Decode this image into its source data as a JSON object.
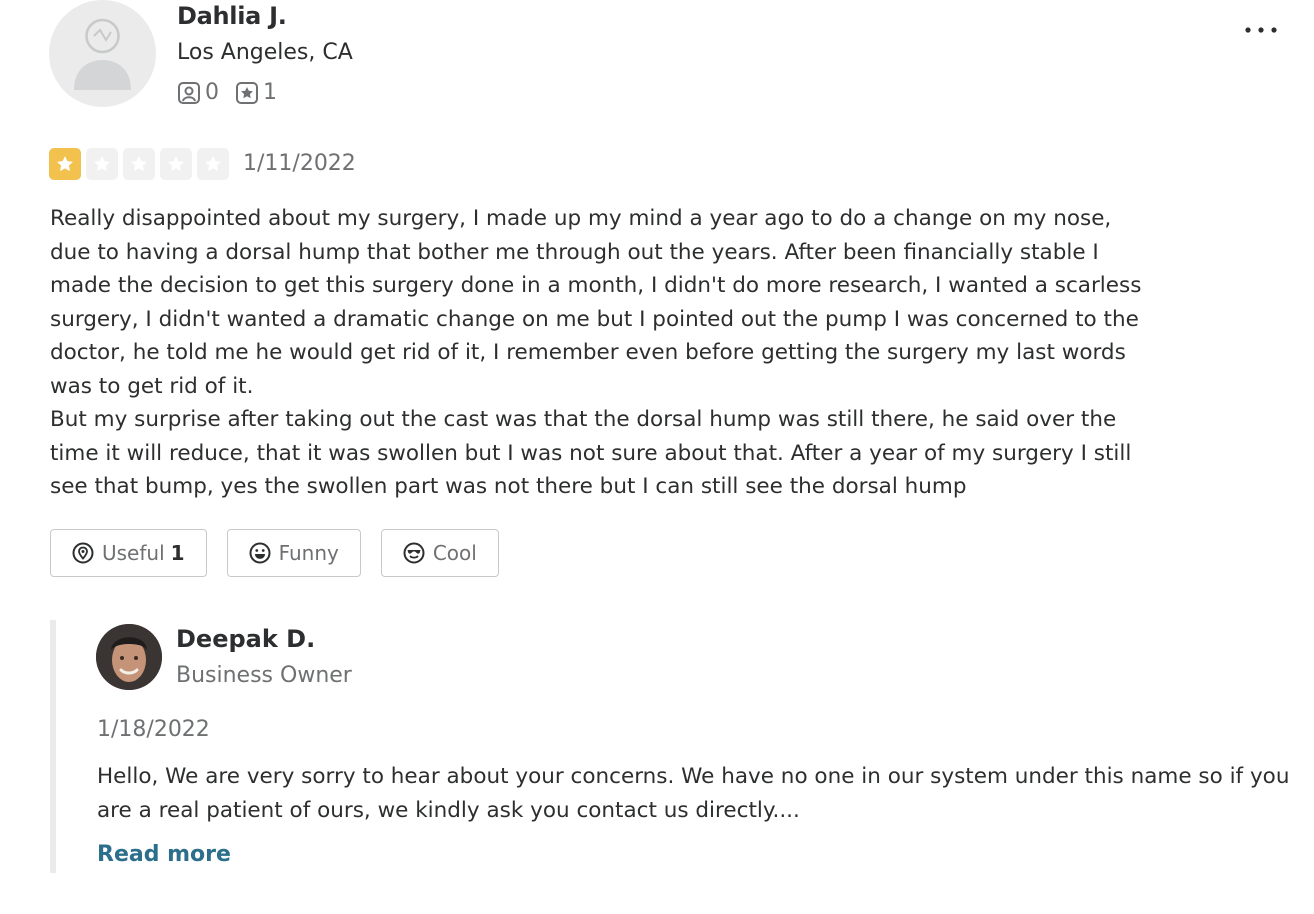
{
  "reviewer": {
    "name": "Dahlia J.",
    "location": "Los Angeles, CA",
    "friends_count": "0",
    "reviews_count": "1",
    "friends_icon": "friends-icon",
    "reviews_icon": "review-star-icon"
  },
  "menu": {
    "more_icon": "more-options-icon"
  },
  "review": {
    "rating": 1,
    "max_rating": 5,
    "date": "1/11/2022",
    "text": "Really disappointed about my surgery, I made up my mind a year ago to do a change on my nose, due to having a dorsal hump that bother me through out the years. After been financially stable I made the decision to get this surgery done in a month, I didn't do more research, I wanted a scarless surgery, I didn't wanted a dramatic change on me but I pointed out the pump I was concerned to the doctor, he told me he would get rid of it, I remember even before getting the surgery my last words was to get rid of it.\nBut my surprise after taking out the cast was that the dorsal hump was still there, he said over the time it will reduce, that it was swollen but I was not sure about that. After a year of my surgery I still see that bump, yes the swollen part was not there but I can still see the dorsal hump"
  },
  "reactions": {
    "useful_label": "Useful",
    "useful_count": "1",
    "funny_label": "Funny",
    "cool_label": "Cool"
  },
  "owner_response": {
    "name": "Deepak D.",
    "role": "Business Owner",
    "date": "1/18/2022",
    "text": "Hello, We are very sorry to hear about your concerns. We have no one in our system under this name so if you are a real patient of ours, we kindly ask you contact us directly....",
    "read_more_label": "Read more"
  },
  "colors": {
    "star_on": "#f2c14e",
    "star_off": "#f1f1f2",
    "link": "#2b6f8c",
    "muted_text": "#6e7072"
  }
}
